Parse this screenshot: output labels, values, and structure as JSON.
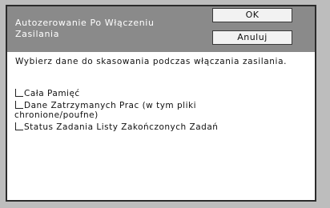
{
  "dialog": {
    "title": "Autozerowanie Po Włączeniu Zasilania",
    "ok_label": "OK",
    "cancel_label": "Anuluj",
    "prompt": "Wybierz dane do skasowania podczas włączania zasilania."
  },
  "options": [
    {
      "label": "Cała Pamięć"
    },
    {
      "label_line1": "Dane Zatrzymanych Prac (w tym pliki",
      "label_line2": "chronione/poufne)"
    },
    {
      "label": "Status Zadania Listy Zakończonych Zadań"
    }
  ]
}
